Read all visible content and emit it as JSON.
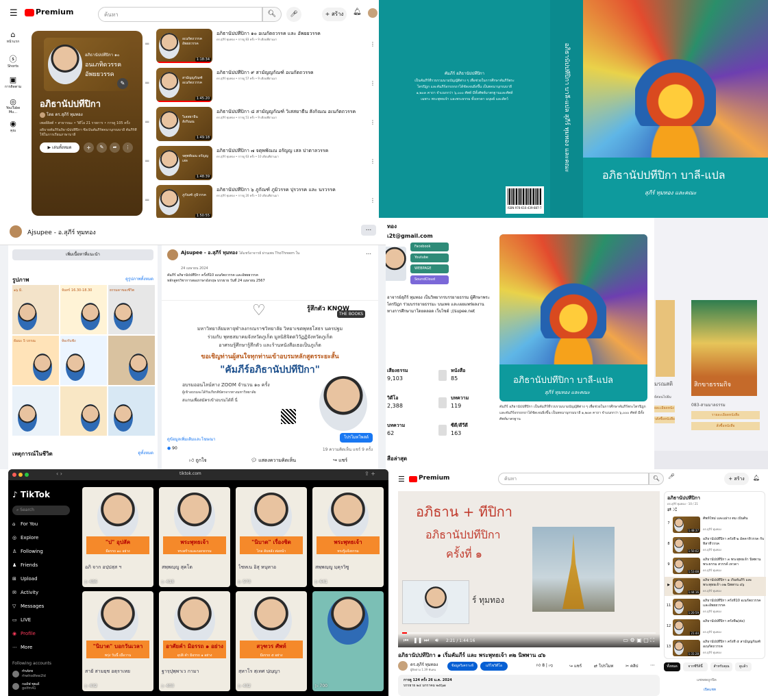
{
  "p1": {
    "brand": "Premium",
    "search_placeholder": "ค้นหา",
    "create_label": "สร้าง",
    "nav": [
      "หน้าแรก",
      "Shorts",
      "การติดตาม",
      "YouTube Mu...",
      "คุณ"
    ],
    "card": {
      "thumb_line1": "อภิธานัปปทีปิกา ๑๐",
      "thumb_line2": "อนเภทิดวรรค",
      "thumb_line3": "อัพยยวรรค",
      "title": "อภิธานัปปทีปิกา",
      "author": "โดย ดร.สุภีร์ ทุมทอง",
      "meta": "เพลย์ลิสต์ • สาธารณะ • วิดีโอ 21 รายการ • การดู 105 ครั้ง",
      "desc": "อธิบายคัมภีร์อภิธานัปปทีปิกา ซึ่งเป็นคัมภีร์พจนานุกรมบาลี คัมภีร์ที่ใช้ในการเรียนภาษาบาลี",
      "play_all": "เล่นทั้งหมด"
    },
    "videos": [
      {
        "title": "อภิธานัปปทีปิกา ๑๐ อเนกัตถวรรค และ อัพยยวรรค",
        "meta": "ดร.สุภีร์ ทุมทอง • การดู 83 ครั้ง • 9 เดือนที่ผ่านมา",
        "thumb": "อเนกัตถวรรค อัพยยวรรค",
        "dur": "1:18:34"
      },
      {
        "title": "อภิธานัปปทีปิกา ๙ สามัญญกัณฑ์ อเนกัตถวรรค",
        "meta": "ดร.สุภีร์ ทุมทอง • การดู 57 ครั้ง • 9 เดือนที่ผ่านมา",
        "thumb": "สามัญญกัณฑ์ อเนกัตถวรรค",
        "dur": "1:45:20"
      },
      {
        "title": "อภิธานัปปทีปิกา ๘ สามัญญกัณฑ์ วิเสสยาธีน สังกิณณ อเนกัตถวรรค",
        "meta": "ดร.สุภีร์ ทุมทอง • การดู 51 ครั้ง • 9 เดือนที่ผ่านมา",
        "thumb": "วิเสสยาธีน สังกิณณ",
        "dur": "1:49:18"
      },
      {
        "title": "อภิธานัปปทีปิกา ๗ จตุพพัณณ อรัญญ เสล ปาตาลวรรค",
        "meta": "ดร.สุภีร์ ทุมทอง • การดู 63 ครั้ง • 10 เดือนที่ผ่านมา",
        "thumb": "จตุพพัณณ อรัญญ เสล",
        "dur": "1:48:39"
      },
      {
        "title": "อภิธานัปปทีปิกา ๖ ภูกัณฑ์ ภูมิวรรค ปุรวรรค และ นรวรรค",
        "meta": "ดร.สุภีร์ ทุมทอง • การดู 20 ครั้ง • 10 เดือนที่ผ่านมา",
        "thumb": "ภูกัณฑ์ ภูมิวรรค",
        "dur": "1:50:55"
      }
    ]
  },
  "p2": {
    "back_title": "คัมภีร์ อภิธานัปปทีปิกา",
    "back_text": "เป็นคัมภีร์ที่รวบรวมนามบัญญัติต่าง ๆ เพื่อช่วยในการศึกษาคัมภีร์พระไตรปิฎก และคัมภีร์อรรถกถาได้ชัดเจนยิ่งขึ้น เป็นพจนานุกรมบาลี ๑,๒๐๓ คาถา จำแนกกว่า ๖,๐๐๐ ศัพท์ มีทั้งศัพท์มาตรฐานและศัพท์เฉพาะ พระพุทธเจ้า และพระธรรม ทั้งเทวดา มนุษย์ และสัตว์",
    "spine": "อภิธานัปปทีปิกา บาลี-แปล  สุภีร์ ทุมทอง และคณะ",
    "isbn": "ISBN 978-616-439-887-7",
    "cover_title": "อภิธานัปปทีปิกา บาลี-แปล",
    "cover_author": "สุภีร์ ทุมทอง และคณะ"
  },
  "p3": {
    "page_name": "Ajsupee - อ.สุภีร์ ทุมทอง",
    "more": "...",
    "add_button": "เพิ่มเนื้อหาที่แนะนำ",
    "photos_title": "รูปภาพ",
    "photos_link": "ดูรูปภาพทั้งหมด",
    "events_title": "เหตุการณ์ในชีวิต",
    "events_link": "ดูทั้งหมด",
    "post": {
      "author": "Ajsupee - อ.สุภีร์ ทุมทอง",
      "sub": "ได้แชร์อาจารย์ ผ่านเพจ ThoThreem ใน",
      "date": "24 เมษายน 2024",
      "text": "คัมภีร์ อภิธานัปปทีปิกา ครั้งที่10 อเนกัตถวรรค และอัพยยวรรค หลักสูตรวิชาการสองภาษาอังกฤษ บรรยาย วันที่ 24 เมษายน 2567",
      "banner_line1": "มหาวิทยาลัยมหาจุฬาลงกรณราชวิทยาลัย วิทยาเขตพุทธโสธร นครปฐม",
      "banner_line2": "ร่วมกับ พุทธสมาคมจังหวัดภูเก็ต มูลนิธิจิตตวิวัฏฏิจังหวัดภูเก็ต",
      "banner_line3": "อาศรมรู้ศึกษารู้สึกตัว และร้านหนังสือเธอเป็นภูเก็ต",
      "banner_invite": "ขอเชิญท่านผู้สนใจทุกท่านเข้าอบรมหลักสูตรระยะสั้น",
      "banner_course": "\"คัมภีร์อภิธานัปปทีปิกา\"",
      "banner_online": "อบรมออนไลน์ทาง ZOOM จำนวน ๑๐ ครั้ง",
      "banner_note": "ผู้เข้าอบรมจะได้รับเกียรติบัตรจากทางมหาวิทยาลัย",
      "banner_scan": "สแกนเพื่อสมัครเข้าอบรมได้ที่ นี่",
      "logo": "THE BOOKS",
      "knowtag": "รู้สึกตัว KNOW",
      "link_text": "ดูข้อมูลเพิ่มเติมและโฆษณา",
      "cta": "โปรโมทโพสต์",
      "reactions": "90",
      "comments_shares": "19 ความคิดเห็น  แชร์ 9 ครั้ง",
      "like": "ถูกใจ",
      "comment": "แสดงความคิดเห็น",
      "share": "แชร์"
    },
    "photo_tags": [
      "๑๖ มิ.",
      "จันทร์ 16.30-18.30",
      "ธรรมดาของชีวิต",
      "ธัมมะ 5 บรรณ",
      "ห้องรับฟัง"
    ]
  },
  "p4": {
    "email": "เ2t@gmail.com",
    "name_frag": "ทอง",
    "social": [
      "Facebook",
      "Youtube",
      "WEBPAGE",
      "SoundCloud"
    ],
    "bio": "อาจารย์สุภีร์ ทุมทอง เป็นวิทยากรบรรยายธรรม ผู้ศึกษาพระไตรปิฎก ร่วมบรรยายธรรมะ บนเพจ และเผยแพร่ผลงานทางการศึกษามาโดยตลอด เว็บไซต์ ://supee.net",
    "stats": [
      {
        "label": "เสียงธรรม",
        "value": "9,103"
      },
      {
        "label": "หนังสือ",
        "value": "85"
      },
      {
        "label": "วิดีโอ",
        "value": "2,388"
      },
      {
        "label": "บทความ",
        "value": "119"
      },
      {
        "label": "บทความ",
        "value": "62"
      },
      {
        "label": "ซีดี/ดีวีดี",
        "value": "163"
      }
    ],
    "latest": "สือล่าสุด",
    "book_title": "อภิธานัปปทีปิกา บาลี-แปล",
    "book_author": "สุภีร์ ทุมทอง และคณะ",
    "book_desc": "คัมภีร์ อภิธานัปปทีปิกา เป็นคัมภีร์ที่รวบรวมนามบัญญัติต่าง ๆ เพื่อช่วยในการศึกษาคัมภีร์พระไตรปิฎก และคัมภีร์อรรถกถาได้ชัดเจนยิ่งขึ้น เป็นพจนานุกรมบาลี ๑,๒๐๓ คาถา จำแนกกว่า ๖,๐๐๐ ศัพท์ มีทั้งศัพท์มาตรฐาน",
    "side_price": "083-สามมาลธรรม",
    "side_btn1": "รายละเอียดหนังสือ",
    "side_btn2": "สั่งซื้อหนังสือ",
    "side_left": "ธ์ค่อนไปธ้ม",
    "side_left2": "ยละเอียดหนัง",
    "side_left3": "วสั่งซื้อหนังสือ",
    "side_tag": "สิกขาธรรมกิจ",
    "side_left_tag": "มรณสติ"
  },
  "p5": {
    "url": "tiktok.com",
    "brand": "TikTok",
    "search": "Search",
    "nav": [
      "For You",
      "Explore",
      "Following",
      "Friends",
      "Upload",
      "Activity",
      "Messages",
      "LIVE",
      "Profile",
      "More"
    ],
    "following_title": "Following accounts",
    "accounts": [
      {
        "name": "rhvbre",
        "sub": "rhwhsdfew2ld"
      },
      {
        "name": "กอลัฟ ซุยเด้",
        "sub": "golfm41"
      }
    ],
    "grid": [
      {
        "caption": "\"ป\" อุปสัค",
        "sub": "มีอรรถ ๑๐ อย่าง",
        "text": "อภิ จาก อปฺปสฺส ฯ",
        "views": "486"
      },
      {
        "caption": "พระพุทธเจ้า",
        "sub": "ทรงสร้างและบอกธรรม",
        "text": "สพฺพญฺญู สุคโต",
        "views": "418"
      },
      {
        "caption": "\"นิบาต\" เรื่องชิด",
        "sub": "ไกล ลับหลัง ต่อหน้า",
        "text": "ไชหเน อิสุ หนุหาอ",
        "views": "573"
      },
      {
        "caption": "พระพุทธเจ้า",
        "sub": "ทรงรู้แจ้งธรรม",
        "text": "สพฺพญฺญู มฺคุรวิซู",
        "views": "641"
      },
      {
        "caption": "\"นิบาต\" บอกวันเวลา",
        "sub": "พรุ่ง วันนี้ เมื่อวาน",
        "text": "สายั สามยฺช อตฺราเหย",
        "views": "432"
      },
      {
        "caption": "อาศัยคำ มิอรรถ ๑ อย่าง",
        "sub": "อุปลิ คำ มิอรรถ ๑ อย่าง",
        "text": "ฐารฺปุพฺพาเว กามา",
        "views": "403"
      },
      {
        "caption": "สวุฑวร ศัพท์",
        "sub": "มีอรรถ ๕ อย่าง",
        "text": "สฺหาโร สฺเทศ ปฺญฺญา",
        "views": "432"
      },
      {
        "caption": "",
        "sub": "",
        "text": "",
        "views": "700"
      }
    ]
  },
  "p6": {
    "brand": "Premium",
    "search_placeholder": "ค้นหา",
    "create_label": "สร้าง",
    "slide_line1": "อภิธาน + ทีปิกา",
    "slide_line2": "อภิธานัปปทีปิกา",
    "slide_line3": "ครั้งที่ ๑",
    "slide_name": "ร์ ทุมทอง",
    "time": "2:21 / 1:44:16",
    "video_title": "อภิธานัปปทีปิกา ๑ เริ่มคัมภีร์ และ พระพุทธเจ้า ๓๒ นิพพาน ๔๖",
    "channel": "ดร.สุภีร์ ทุมทอง",
    "subs": "ผู้ติดตาม 1.39 พันคน",
    "analytics": "ข้อมูลวิเคราะห์",
    "edit": "แก้ไขวิดีโอ",
    "likes": "8",
    "share": "แชร์",
    "download": "โปรโมท",
    "clip": "คลิป",
    "desc_meta": "การดู 124 ครั้ง 26 ม.ค. 2024",
    "desc_text": "บรรยาย ๒๔ มกราคม ๒๕๖๗",
    "playlist_title": "อภิธานัปปทีปิกา",
    "playlist_sub": "ดร.สุภีร์ ทุมทอง - 10 / 21",
    "playlist": [
      {
        "n": "7",
        "title": "ศัพท์ใหม่ และแผ่าง ตม เป็นต้น",
        "sub": "ดร.สุภีร์ ทุมทอง",
        "dur": "1:48:37"
      },
      {
        "n": "8",
        "title": "อภิธานัปปทีปิกา ครั้งที่ ๒ อัคคาทิวรรค กับ ทิสาทีวรรค",
        "sub": "ดร.สุภีร์ ทุมทอง",
        "dur": "1:50:02"
      },
      {
        "n": "9",
        "title": "อภิธานัปปทีปิกา ๓ พระพุทธเจ้า นิพพาน พระธรรม สวรรค์ เทวดา",
        "sub": "ดร.สุภีร์ ทุมทอง",
        "dur": "1:53:08"
      },
      {
        "n": "▶",
        "title": "อภิธานัปปทีปิกา ๑ เริ่มคัมภีร์ และ พระพุทธเจ้า ๓๒ นิพพาน ๔๖",
        "sub": "ดร.สุภีร์ ทุมทอง",
        "dur": "1:44:16"
      },
      {
        "n": "11",
        "title": "อภิธานัปปทีปิกา ครั้งที่10 อเนกัตถวรรค และอัพยยวรรค",
        "sub": "ดร.สุภีร์ ทุมทอง",
        "dur": "1:20:59"
      },
      {
        "n": "12",
        "title": "อภิธานัปปทีปิกา ครั้งที่๒(ต่อ)",
        "sub": "ดร.สุภีร์ ทุมทอง",
        "dur": "21:44"
      },
      {
        "n": "13",
        "title": "อภิธานัปปทีปิกา ครั้งที่ ๕ สามัญญกัณฑ์ อเนกัตถวรรค",
        "sub": "ดร.สุภีร์ ทุมทอง",
        "dur": "1:31:28"
      }
    ],
    "chips": [
      "ทั้งหมด",
      "จากซีรีส์นี้",
      "สำหรับคุณ",
      "ดูแล้ว"
    ],
    "live_note": "แชทสดถูกปิด",
    "live_link": "เปิดแชท"
  }
}
